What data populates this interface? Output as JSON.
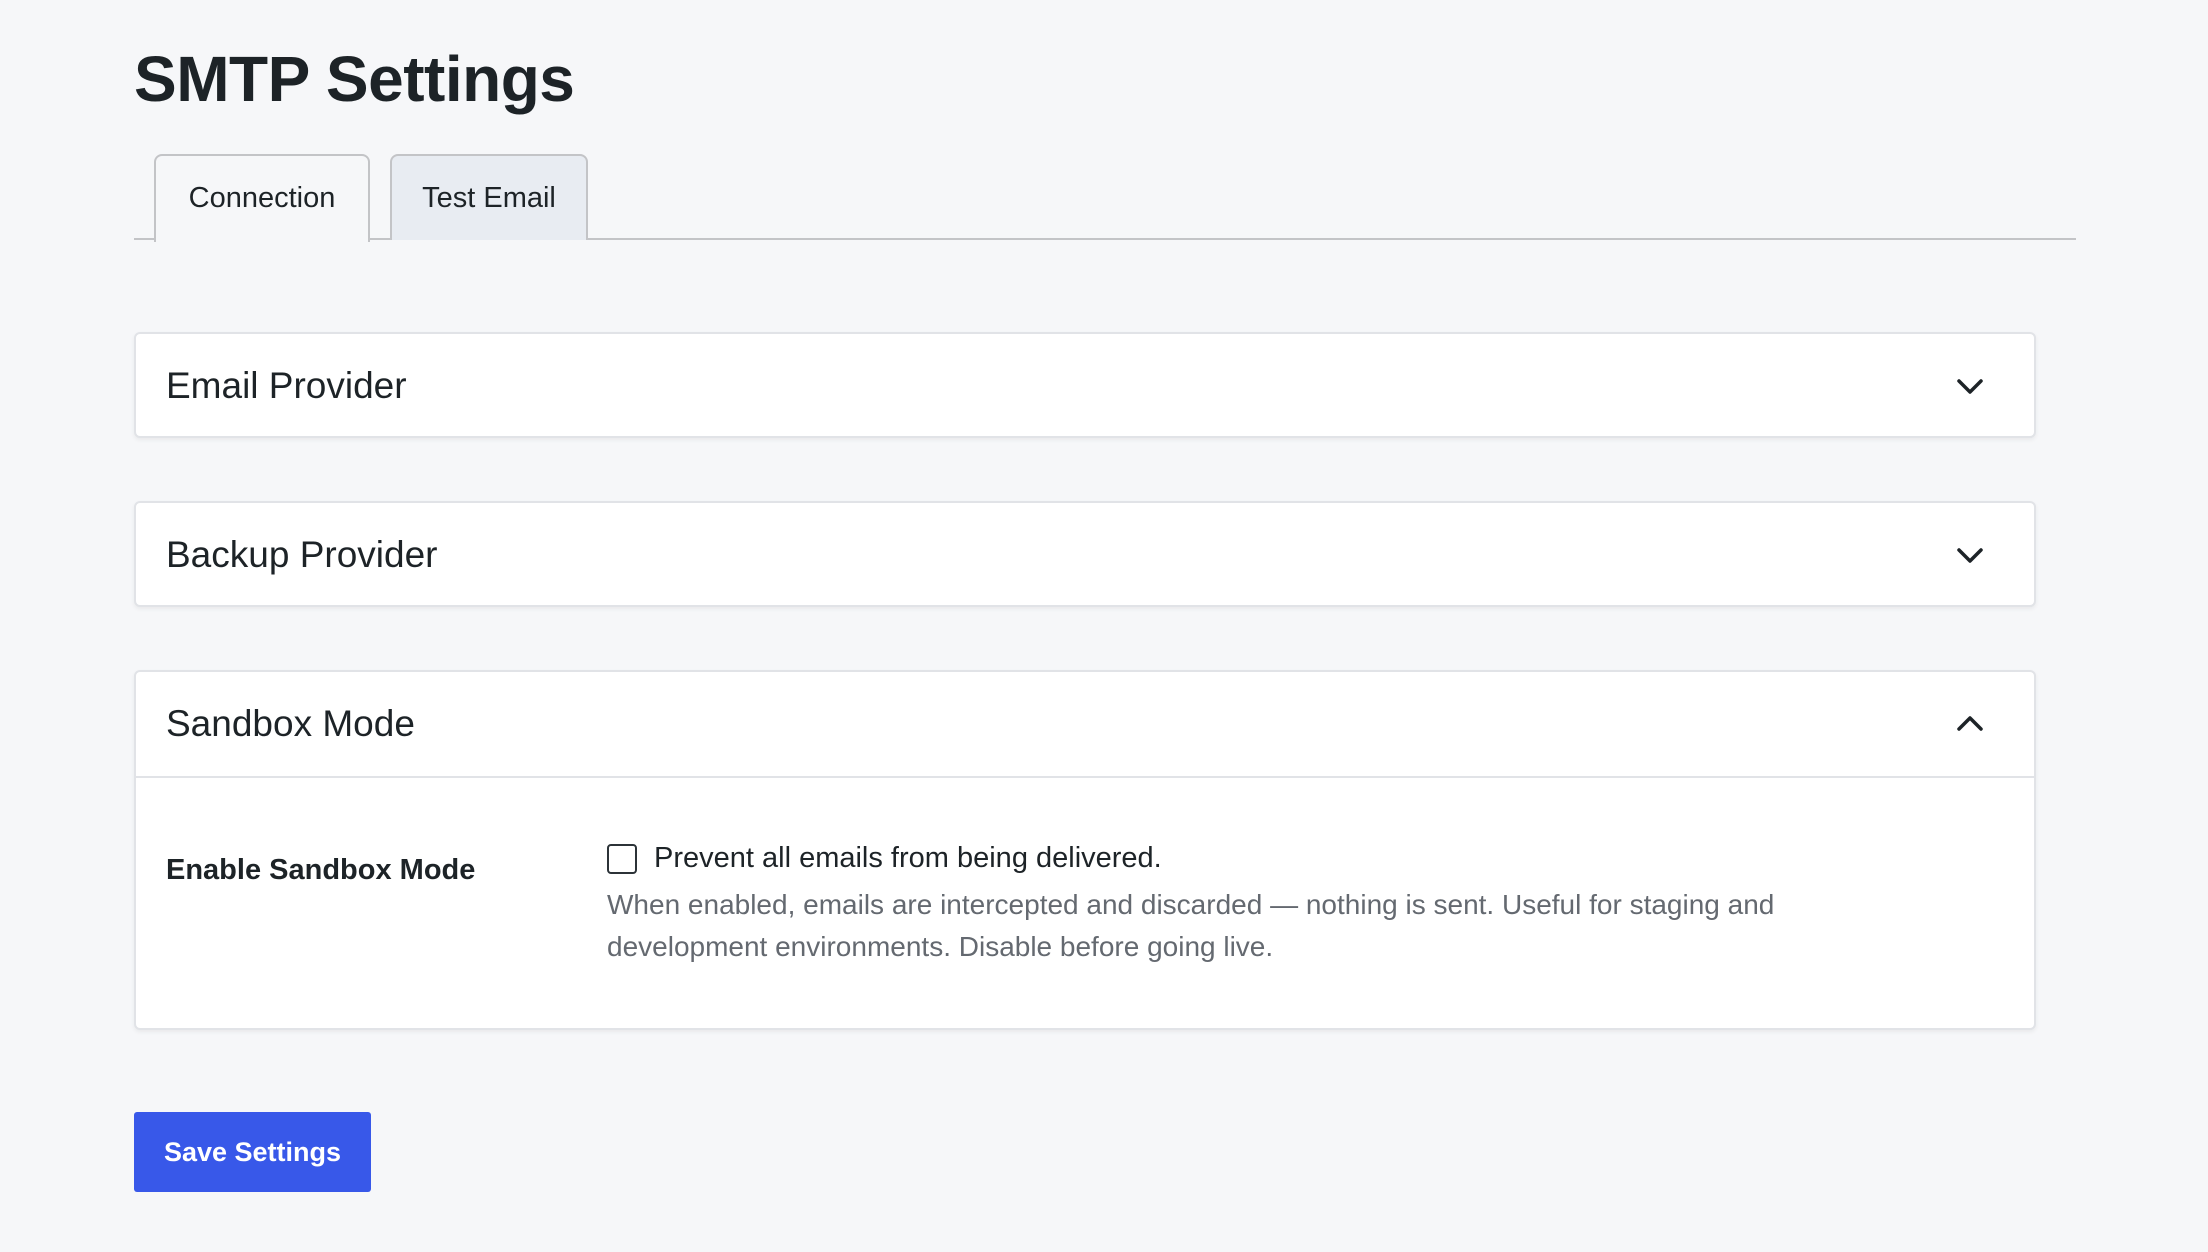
{
  "page": {
    "title": "SMTP Settings"
  },
  "tabs": [
    {
      "label": "Connection",
      "active": true
    },
    {
      "label": "Test Email",
      "active": false
    }
  ],
  "sections": [
    {
      "title": "Email Provider",
      "expanded": false,
      "icon": "chevron-down-icon"
    },
    {
      "title": "Backup Provider",
      "expanded": false,
      "icon": "chevron-down-icon"
    },
    {
      "title": "Sandbox Mode",
      "expanded": true,
      "icon": "chevron-up-icon",
      "fields": [
        {
          "label": "Enable Sandbox Mode",
          "checkbox_label": "Prevent all emails from being delivered.",
          "checked": false,
          "description": "When enabled, emails are intercepted and discarded — nothing is sent. Useful for staging and development environments. Disable before going live."
        }
      ]
    }
  ],
  "actions": {
    "save_label": "Save Settings"
  },
  "colors": {
    "background": "#f6f7f9",
    "primary": "#3858e9",
    "text": "#1d2327",
    "muted_text": "#646970",
    "border": "#c3c4c7"
  }
}
